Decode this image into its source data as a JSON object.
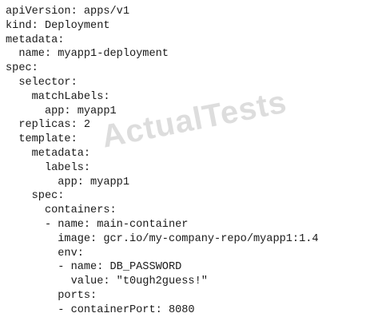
{
  "code_lines": [
    "apiVersion: apps/v1",
    "kind: Deployment",
    "metadata:",
    "  name: myapp1-deployment",
    "spec:",
    "  selector:",
    "    matchLabels:",
    "      app: myapp1",
    "  replicas: 2",
    "  template:",
    "    metadata:",
    "      labels:",
    "        app: myapp1",
    "    spec:",
    "      containers:",
    "      - name: main-container",
    "        image: gcr.io/my-company-repo/myapp1:1.4",
    "        env:",
    "        - name: DB_PASSWORD",
    "          value: \"t0ugh2guess!\"",
    "        ports:",
    "        - containerPort: 8080"
  ],
  "watermark": "ActualTests"
}
